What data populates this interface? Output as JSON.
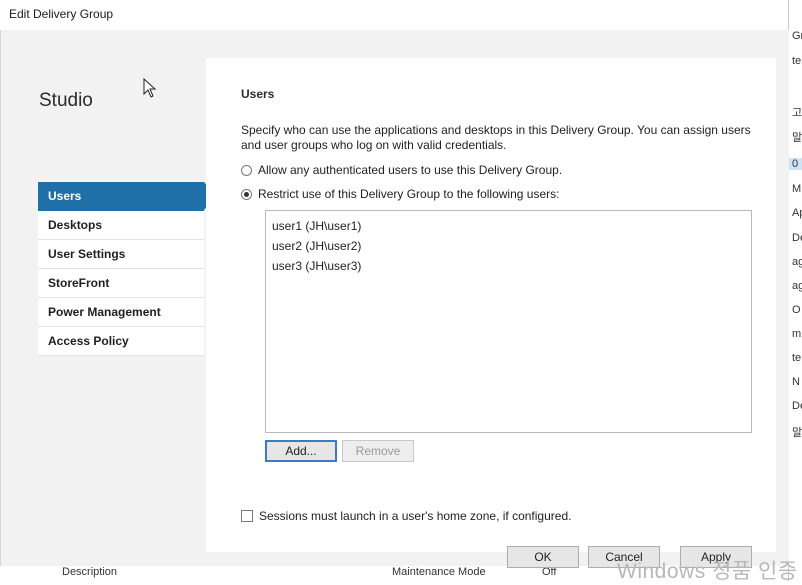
{
  "window": {
    "title": "Edit Delivery Group"
  },
  "sidebar": {
    "brand": "Studio",
    "items": [
      {
        "label": "Users",
        "active": true
      },
      {
        "label": "Desktops",
        "active": false
      },
      {
        "label": "User Settings",
        "active": false
      },
      {
        "label": "StoreFront",
        "active": false
      },
      {
        "label": "Power Management",
        "active": false
      },
      {
        "label": "Access Policy",
        "active": false
      }
    ]
  },
  "main": {
    "title": "Users",
    "description": "Specify who can use the applications and desktops in this Delivery Group. You can assign users and user groups who log on with valid credentials.",
    "option_all": "Allow any authenticated users to use this Delivery Group.",
    "option_restrict": "Restrict use of this Delivery Group to the following users:",
    "selected_option": "restrict",
    "users": [
      "user1 (JH\\user1)",
      "user2 (JH\\user2)",
      "user3 (JH\\user3)"
    ],
    "add_label": "Add...",
    "remove_label": "Remove",
    "home_zone_label": "Sessions must launch in a user's home zone, if configured.",
    "home_zone_checked": false
  },
  "footer": {
    "ok_label": "OK",
    "cancel_label": "Cancel",
    "apply_label": "Apply"
  },
  "background": {
    "right_strip": [
      "Gr",
      "te",
      "고",
      "말",
      "0",
      "M",
      "Ap",
      "De",
      "ag",
      "ag",
      "O",
      "m",
      "te",
      "N",
      "De",
      "말"
    ],
    "bottom_strip": [
      "Description",
      "Maintenance Mode",
      "Off"
    ],
    "watermark": "Windows 정품 인증"
  },
  "colors": {
    "accent": "#1f6fa8",
    "pane_bg": "#f2f2f2",
    "content_bg": "#ffffff"
  }
}
